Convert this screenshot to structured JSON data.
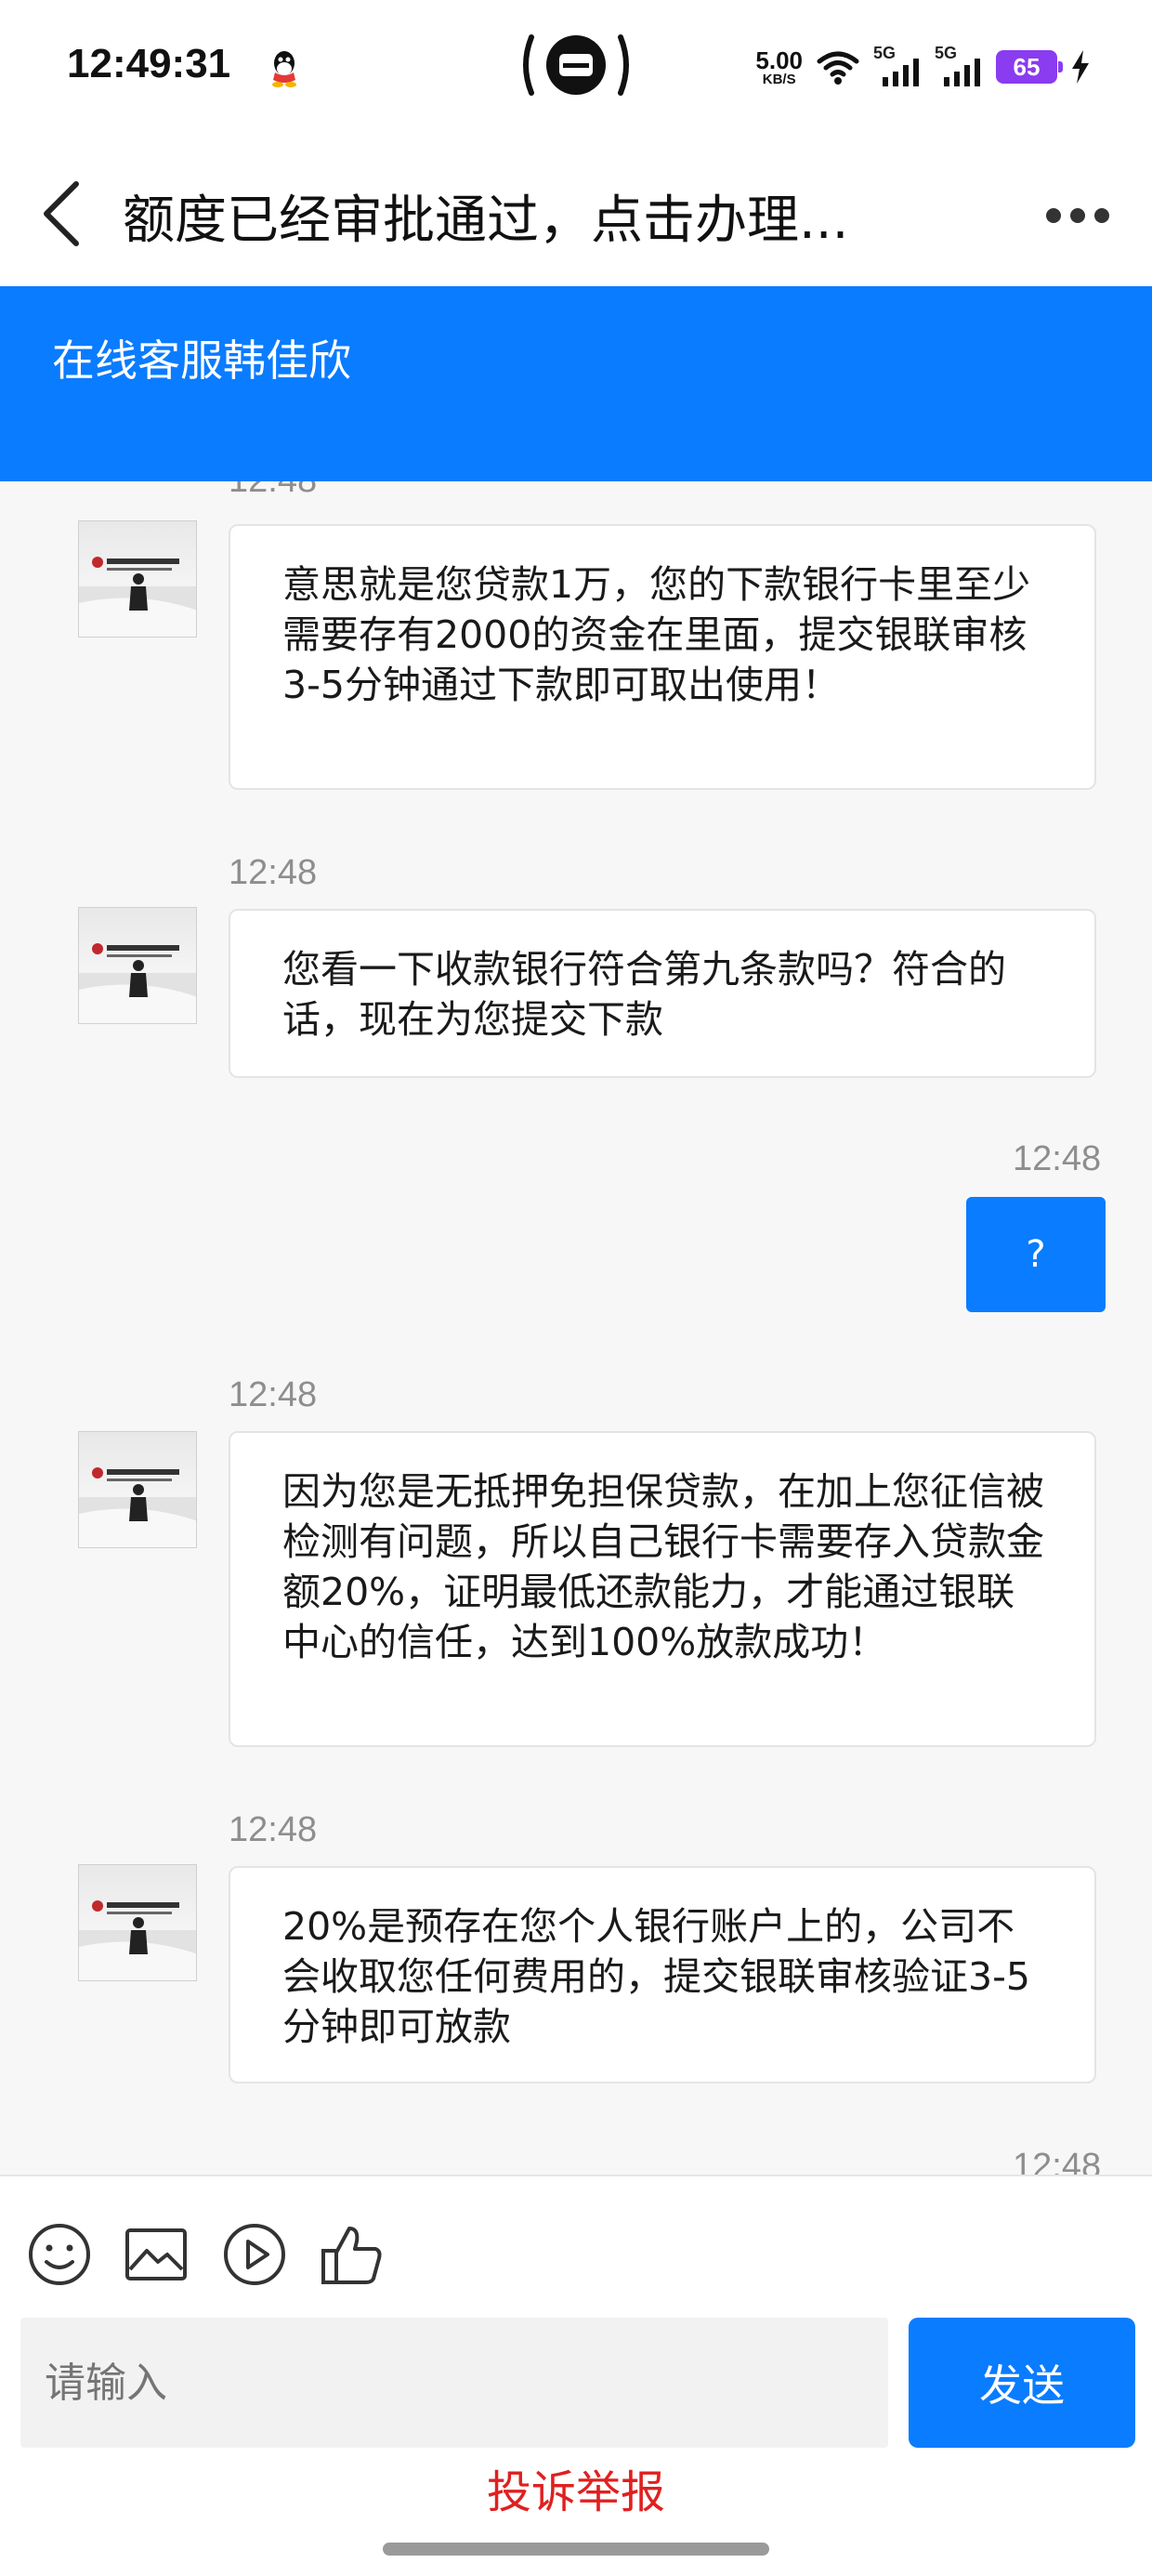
{
  "status_bar": {
    "time": "12:49:31",
    "net_speed_value": "5.00",
    "net_speed_unit": "KB/S",
    "signal1_label": "5G",
    "signal2_label": "5G",
    "battery_level": "65"
  },
  "title_bar": {
    "title": "额度已经审批通过，点击办理..."
  },
  "header": {
    "agent_name": "在线客服韩佳欣"
  },
  "messages": [
    {
      "time": "12:48",
      "from": "agent",
      "text": "意思就是您贷款1万，您的下款银行卡里至少需要存有2000的资金在里面，提交银联审核3-5分钟通过下款即可取出使用！"
    },
    {
      "time": "12:48",
      "from": "agent",
      "text": "您看一下收款银行符合第九条款吗？符合的话，现在为您提交下款"
    },
    {
      "time": "12:48",
      "from": "user",
      "text": "?"
    },
    {
      "time": "12:48",
      "from": "agent",
      "text": "因为您是无抵押免担保贷款，在加上您征信被检测有问题，所以自己银行卡需要存入贷款金额20%，证明最低还款能力，才能通过银联中心的信任，达到100%放款成功！"
    },
    {
      "time": "12:48",
      "from": "agent",
      "text": "20%是预存在您个人银行账户上的，公司不会收取您任何费用的，提交银联审核验证3-5分钟即可放款"
    },
    {
      "time": "12:48",
      "from": "agent",
      "text": ""
    }
  ],
  "composer": {
    "placeholder": "请输入",
    "send_label": "发送",
    "report_label": "投诉举报"
  },
  "colors": {
    "accent": "#0a7cff",
    "report": "#e02020",
    "battery": "#8a3cf0"
  },
  "icons": {
    "toolbar": [
      "emoji-icon",
      "image-icon",
      "video-icon",
      "thumbs-up-icon"
    ]
  }
}
